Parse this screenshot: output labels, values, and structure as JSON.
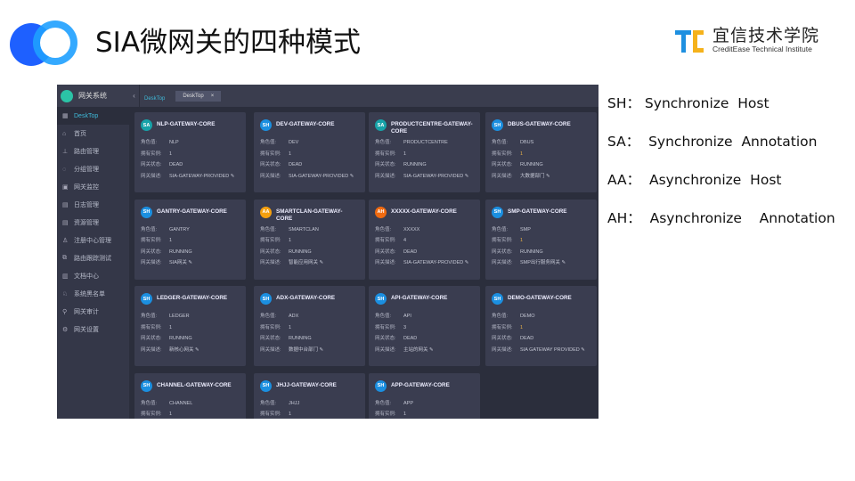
{
  "slide": {
    "title": "SIA微网关的四种模式",
    "brand_cn": "宜信技术学院",
    "brand_en": "CreditEase Technical Institute"
  },
  "app": {
    "title": "网关系统",
    "breadcrumb": "DeskTop",
    "tab": "DeskTop",
    "tab_close": "×",
    "collapse": "‹",
    "sidebar": [
      {
        "icon": "▦",
        "label": "DeskTop",
        "active": true
      },
      {
        "icon": "⌂",
        "label": "首页"
      },
      {
        "icon": "⊥",
        "label": "路由管理"
      },
      {
        "icon": "◌",
        "label": "分组管理"
      },
      {
        "icon": "▣",
        "label": "网关监控"
      },
      {
        "icon": "▤",
        "label": "日志管理"
      },
      {
        "icon": "▤",
        "label": "资源管理"
      },
      {
        "icon": "♙",
        "label": "注册中心管理"
      },
      {
        "icon": "⧉",
        "label": "路由跟踪测试"
      },
      {
        "icon": "▥",
        "label": "文档中心"
      },
      {
        "icon": "♘",
        "label": "系统黑名单"
      },
      {
        "icon": "⚲",
        "label": "网关审计"
      },
      {
        "icon": "⚙",
        "label": "网关设置"
      }
    ],
    "field_labels": [
      "角色值:",
      "拥有实例:",
      "网关状态:",
      "网关描述:"
    ],
    "cards": [
      {
        "mode": "SA",
        "name": "NLP-GATEWAY-CORE",
        "role": "NLP",
        "instances": "1",
        "status": "DEAD",
        "desc": "SIA-GATEWAY-PROVIDED ✎"
      },
      {
        "mode": "SH",
        "name": "DEV-GATEWAY-CORE",
        "role": "DEV",
        "instances": "1",
        "status": "DEAD",
        "desc": "SIA-GATEWAY-PROVIDED ✎"
      },
      {
        "mode": "SA",
        "name": "PRODUCTCENTRE-GATEWAY-CORE",
        "role": "PRODUCTCENTRE",
        "instances": "1",
        "status": "RUNNING",
        "desc": "SIA-GATEWAY-PROVIDED ✎"
      },
      {
        "mode": "SH",
        "name": "DBUS-GATEWAY-CORE",
        "role": "DBUS",
        "instances": "1",
        "status": "RUNNING",
        "desc": "大数据部门 ✎"
      },
      {
        "mode": "SH",
        "name": "GANTRY-GATEWAY-CORE",
        "role": "GANTRY",
        "instances": "1",
        "status": "RUNNING",
        "desc": "SIA网关 ✎"
      },
      {
        "mode": "AA",
        "name": "SMARTCLAN-GATEWAY-CORE",
        "role": "SMARTCLAN",
        "instances": "1",
        "status": "RUNNING",
        "desc": "智能应用网关 ✎"
      },
      {
        "mode": "AH",
        "name": "XXXXX-GATEWAY-CORE",
        "role": "XXXXX",
        "instances": "4",
        "status": "DEAD",
        "desc": "SIA-GATEWAY-PROVIDED ✎"
      },
      {
        "mode": "SH",
        "name": "SMP-GATEWAY-CORE",
        "role": "SMP",
        "instances": "1",
        "status": "RUNNING",
        "desc": "SMP出行服务网关 ✎"
      },
      {
        "mode": "SH",
        "name": "LEDGER-GATEWAY-CORE",
        "role": "LEDGER",
        "instances": "1",
        "status": "RUNNING",
        "desc": "新核心网关 ✎"
      },
      {
        "mode": "SH",
        "name": "ADX-GATEWAY-CORE",
        "role": "ADX",
        "instances": "1",
        "status": "RUNNING",
        "desc": "数据中台部门 ✎"
      },
      {
        "mode": "SH",
        "name": "API-GATEWAY-CORE",
        "role": "API",
        "instances": "3",
        "status": "DEAD",
        "desc": "主站的网关 ✎"
      },
      {
        "mode": "SH",
        "name": "DEMO-GATEWAY-CORE",
        "role": "DEMO",
        "instances": "1",
        "status": "DEAD",
        "desc": "SIA GATEWAY PROVIDED ✎"
      },
      {
        "mode": "SH",
        "name": "CHANNEL-GATEWAY-CORE",
        "role": "CHANNEL",
        "instances": "1",
        "status": "",
        "desc": ""
      },
      {
        "mode": "SH",
        "name": "JHJJ-GATEWAY-CORE",
        "role": "JHJJ",
        "instances": "1",
        "status": "",
        "desc": ""
      },
      {
        "mode": "SH",
        "name": "APP-GATEWAY-CORE",
        "role": "APP",
        "instances": "1",
        "status": "",
        "desc": ""
      }
    ]
  },
  "mode_colors": {
    "SA": "#17a2a8",
    "SH": "#1b8fe0",
    "AA": "#f5a00f",
    "AH": "#f06a10"
  },
  "legend": [
    {
      "abbr": "SH：",
      "text": " Synchronize  Host"
    },
    {
      "abbr": "SA：",
      "text": "  Synchronize  Annotation"
    },
    {
      "abbr": "AA：",
      "text": "  Asynchronize  Host"
    },
    {
      "abbr": "AH：",
      "text": "  Asynchronize    Annotation"
    }
  ]
}
